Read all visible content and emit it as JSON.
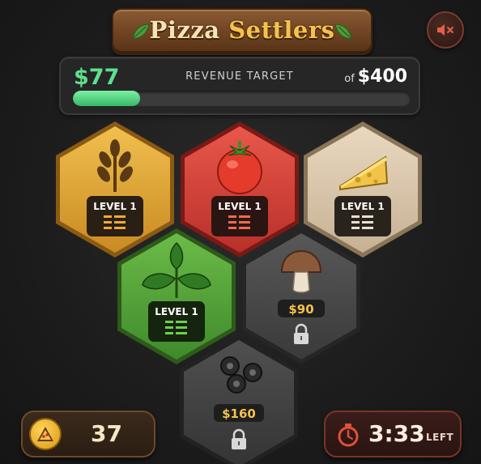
{
  "title": {
    "part1": "Pizza",
    "part2": "Settlers"
  },
  "sound": {
    "icon": "speaker-muted-icon",
    "state": "muted"
  },
  "revenue": {
    "current": "$77",
    "label": "REVENUE TARGET",
    "target_prefix": "of",
    "target": "$400",
    "progress": 0.2
  },
  "tiles": [
    {
      "id": "wheat",
      "icon": "wheat-icon",
      "status": "LEVEL 1",
      "color": "#e3a93a"
    },
    {
      "id": "tomato",
      "icon": "tomato-icon",
      "status": "LEVEL 1",
      "color": "#d94536"
    },
    {
      "id": "cheese",
      "icon": "cheese-icon",
      "status": "LEVEL 1",
      "color": "#d9c4a8"
    },
    {
      "id": "basil",
      "icon": "basil-icon",
      "status": "LEVEL 1",
      "color": "#5aa83a"
    },
    {
      "id": "mushroom",
      "icon": "mushroom-icon",
      "price": "$90",
      "locked": true,
      "color": "#4a4a4a"
    },
    {
      "id": "olives",
      "icon": "olives-icon",
      "price": "$160",
      "locked": true,
      "color": "#444444"
    }
  ],
  "pizza_count": {
    "icon": "pizza-slice-icon",
    "value": "37"
  },
  "timer": {
    "icon": "stopwatch-icon",
    "value": "3:33",
    "suffix": "LEFT"
  },
  "colors": {
    "revenue_green": "#5fe08f",
    "price_gold": "#f5c24a"
  }
}
